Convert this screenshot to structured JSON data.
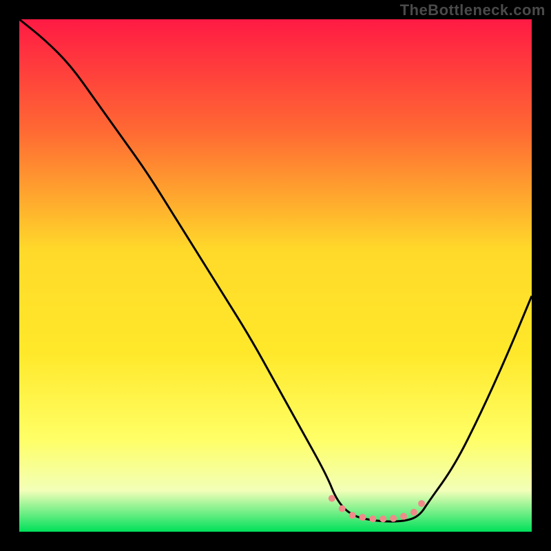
{
  "watermark": "TheBottleneck.com",
  "chart_data": {
    "type": "line",
    "title": "",
    "xlabel": "",
    "ylabel": "",
    "xlim": [
      0,
      100
    ],
    "ylim": [
      0,
      100
    ],
    "background_gradient": {
      "top": "#ff1a44",
      "mid_upper": "#ff7a2a",
      "mid": "#ffd92a",
      "mid_lower": "#ffff66",
      "lower": "#f7ffb0",
      "bottom": "#00e05a"
    },
    "series": [
      {
        "name": "bottleneck-curve",
        "color": "#000000",
        "x": [
          0,
          5,
          10,
          15,
          20,
          25,
          30,
          35,
          40,
          45,
          50,
          55,
          60,
          62,
          65,
          70,
          75,
          78,
          80,
          85,
          90,
          95,
          100
        ],
        "y": [
          100,
          96,
          91,
          84,
          77,
          70,
          62,
          54,
          46,
          38,
          29,
          20,
          11,
          6,
          3,
          2,
          2,
          3,
          6,
          13,
          23,
          34,
          46
        ]
      }
    ],
    "markers": {
      "name": "optimal-range",
      "color": "#f08a8a",
      "points": [
        {
          "x": 61,
          "y": 6.5
        },
        {
          "x": 63,
          "y": 4.5
        },
        {
          "x": 65,
          "y": 3.2
        },
        {
          "x": 67,
          "y": 2.8
        },
        {
          "x": 69,
          "y": 2.5
        },
        {
          "x": 71,
          "y": 2.5
        },
        {
          "x": 73,
          "y": 2.6
        },
        {
          "x": 75,
          "y": 3.0
        },
        {
          "x": 77,
          "y": 3.8
        },
        {
          "x": 78.5,
          "y": 5.5
        }
      ],
      "radius": 5
    }
  }
}
